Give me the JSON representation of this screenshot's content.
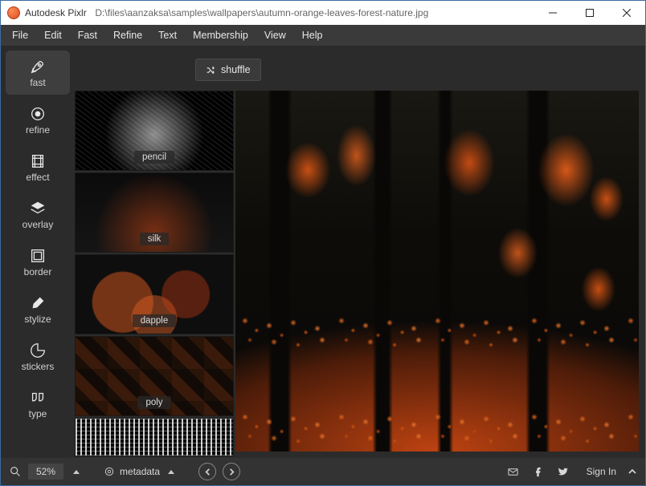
{
  "titlebar": {
    "app_name": "Autodesk Pixlr",
    "file_path": "D:\\files\\aanzaksa\\samples\\wallpapers\\autumn-orange-leaves-forest-nature.jpg"
  },
  "menubar": [
    "File",
    "Edit",
    "Fast",
    "Refine",
    "Text",
    "Membership",
    "View",
    "Help"
  ],
  "sidebar": {
    "tools": [
      {
        "id": "fast",
        "label": "fast",
        "icon": "rocket-icon",
        "selected": true
      },
      {
        "id": "refine",
        "label": "refine",
        "icon": "target-icon",
        "selected": false
      },
      {
        "id": "effect",
        "label": "effect",
        "icon": "film-icon",
        "selected": false
      },
      {
        "id": "overlay",
        "label": "overlay",
        "icon": "layers-icon",
        "selected": false
      },
      {
        "id": "border",
        "label": "border",
        "icon": "frame-icon",
        "selected": false
      },
      {
        "id": "stylize",
        "label": "stylize",
        "icon": "brush-icon",
        "selected": false
      },
      {
        "id": "stickers",
        "label": "stickers",
        "icon": "sticker-icon",
        "selected": false
      },
      {
        "id": "type",
        "label": "type",
        "icon": "quote-icon",
        "selected": false
      }
    ]
  },
  "toolbar": {
    "shuffle_label": "shuffle"
  },
  "style_thumbs": [
    {
      "id": "pencil",
      "label": "pencil"
    },
    {
      "id": "silk",
      "label": "silk"
    },
    {
      "id": "dapple",
      "label": "dapple"
    },
    {
      "id": "poly",
      "label": "poly"
    }
  ],
  "statusbar": {
    "zoom": "52%",
    "metadata_label": "metadata",
    "signin_label": "Sign In"
  }
}
